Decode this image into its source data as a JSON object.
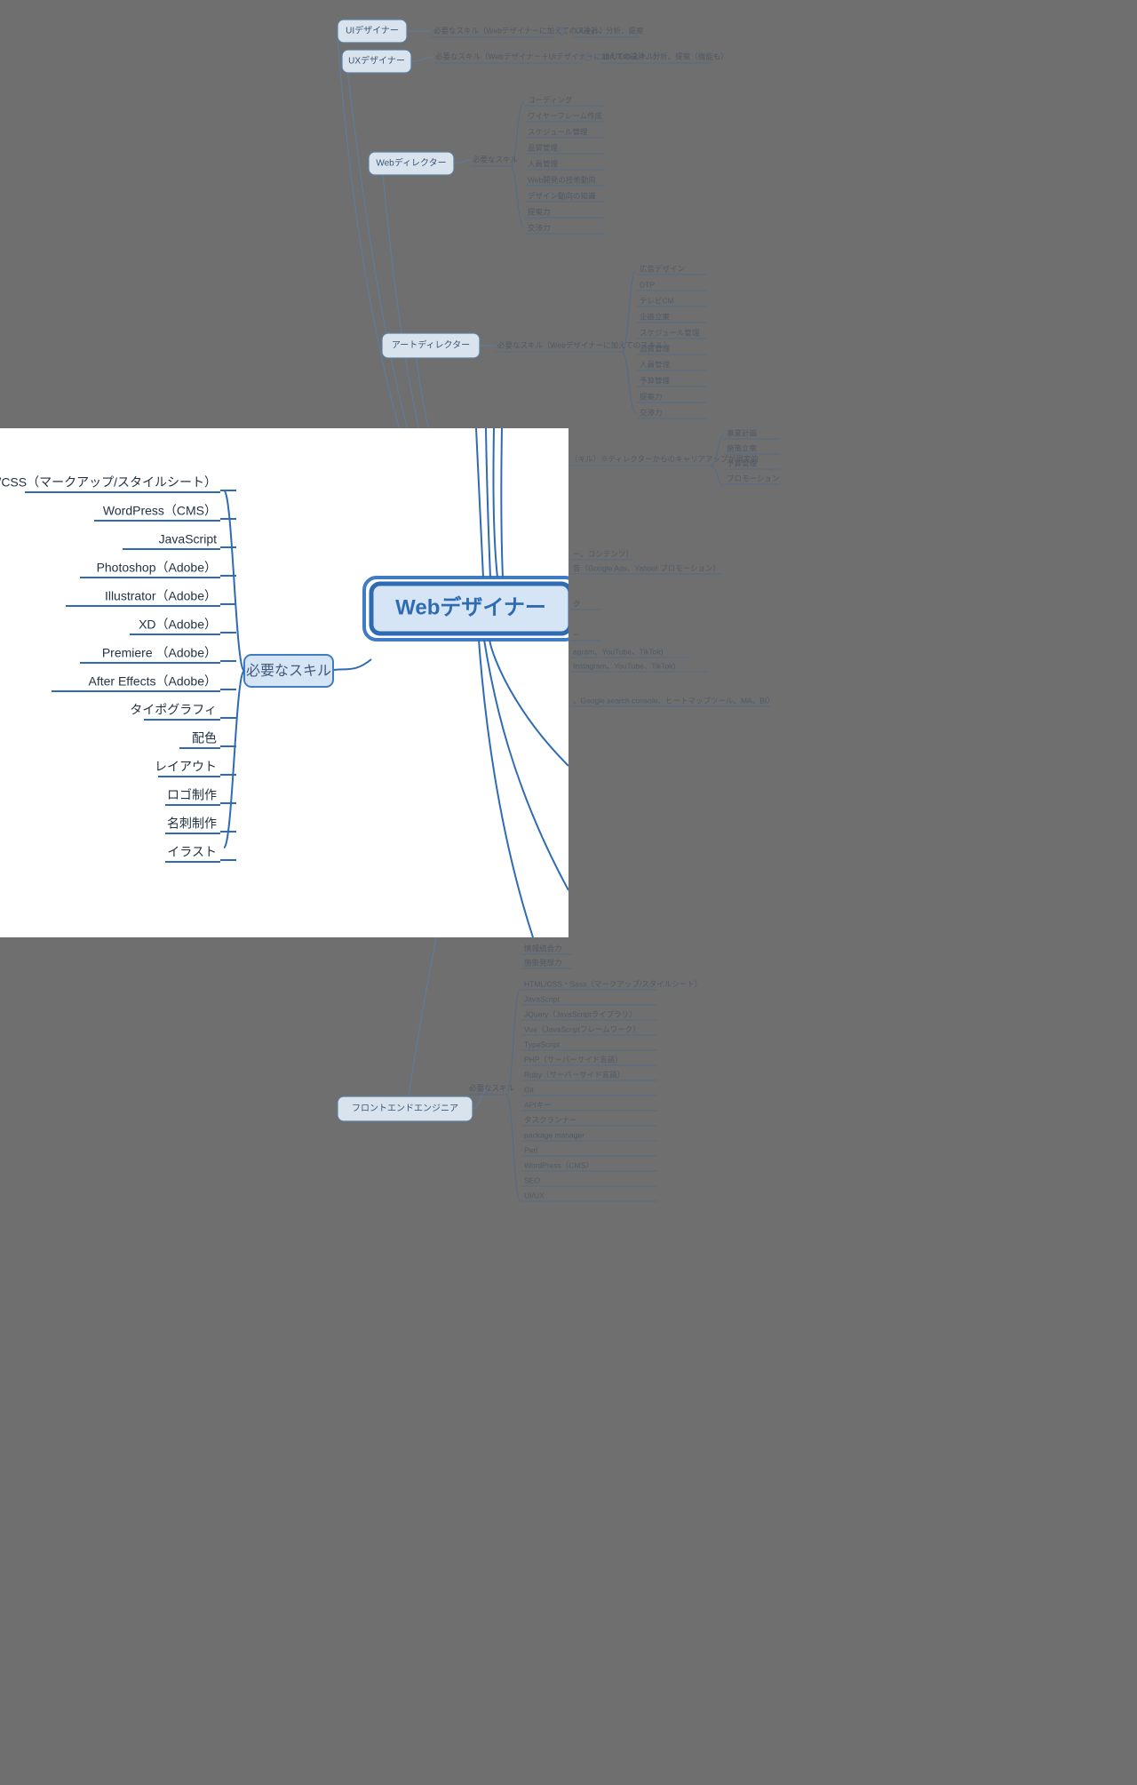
{
  "root": "Webデザイナー",
  "required_label": "必要なスキル",
  "skills": [
    "HTML/CSS（マークアップ/スタイルシート）",
    "WordPress（CMS）",
    "JavaScript",
    "Photoshop（Adobe）",
    "Illustrator（Adobe）",
    "XD（Adobe）",
    "Premiere （Adobe）",
    "After Effects（Adobe）",
    "タイポグラフィ",
    "配色",
    "レイアウト",
    "ロゴ制作",
    "名刺制作",
    "イラスト"
  ],
  "ui_designer": {
    "label": "UIデザイナー",
    "req": "必要なスキル（Webデザイナーに加えてのスキル）",
    "items": [
      "UI設計、分析、提案"
    ]
  },
  "ux_designer": {
    "label": "UXデザイナー",
    "req": "必要なスキル（Webデザイナー＋UIデザイナーに加えてのスキル）",
    "items": [
      "UI/UXの設計、分析、提案（機能も）"
    ]
  },
  "web_director": {
    "label": "Webディレクター",
    "req": "必要なスキル",
    "items": [
      "コーディング",
      "ワイヤーフレーム作成",
      "スケジュール管理",
      "品質管理",
      "人員管理",
      "Web開発の技術動向",
      "デザイン動向の知識",
      "提案力",
      "交渉力"
    ]
  },
  "art_director": {
    "label": "アートディレクター",
    "req": "必要なスキル（Webデザイナーに加えてのスキル）",
    "items": [
      "広告デザイン",
      "DTP",
      "テレビCM",
      "企画立案",
      "スケジュール管理",
      "品質管理",
      "人員管理",
      "予算管理",
      "提案力",
      "交渉力"
    ]
  },
  "producer": {
    "req_note": "（キル）※ディレクターからのキャリアアップが現実的",
    "items": [
      "事業計画",
      "施策立案",
      "予算管理",
      "プロモーション"
    ]
  },
  "marketer": {
    "items": [
      "ー、コンテンツ）",
      "告（Google Ads、Yahoo! プロモーション）",
      "ク",
      "ー",
      "agram、YouTube、TikTok)",
      "Instagram、YouTube、TikTok)",
      "、Google search console、ヒートマップツール、MA、BI）"
    ]
  },
  "analyst": {
    "items": [
      "情報統合力",
      "施策発想力"
    ]
  },
  "frontend": {
    "label": "フロントエンドエンジニア",
    "req": "必要なスキル",
    "items": [
      "HTML/CSS・Sass（マークアップ/スタイルシート）",
      "JavaScript",
      "JQuery（JavaScriptライブラリ）",
      "Vue（JavaScriptフレームワーク）",
      "TypeScript",
      "PHP（サーバーサイド言語）",
      "Ruby（サーバーサイド言語）",
      "Git",
      "APIキー",
      "タスクランナー",
      "package manager",
      "Perl",
      "WordPress（CMS）",
      "SEO",
      "UI/UX"
    ]
  }
}
